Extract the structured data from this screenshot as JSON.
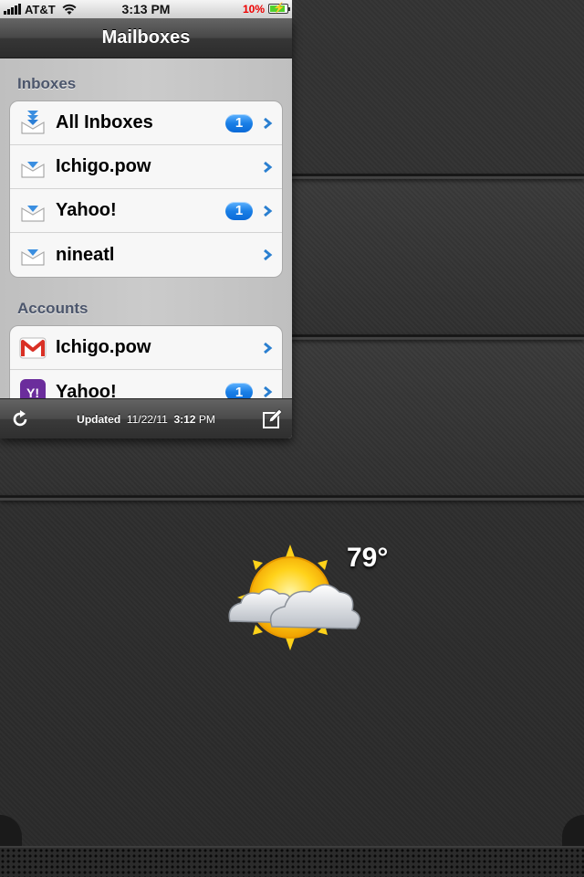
{
  "status_bar": {
    "carrier": "AT&T",
    "time": "3:13 PM",
    "battery_percent": "10%",
    "signal_bars": 4
  },
  "mail": {
    "title": "Mailboxes",
    "sections": [
      {
        "header": "Inboxes",
        "rows": [
          {
            "label": "All Inboxes",
            "badge": "1",
            "icon": "all-inboxes-icon"
          },
          {
            "label": "Ichigo.pow",
            "badge": "",
            "icon": "inbox-tray-icon"
          },
          {
            "label": "Yahoo!",
            "badge": "1",
            "icon": "inbox-tray-icon"
          },
          {
            "label": "nineatl",
            "badge": "",
            "icon": "inbox-tray-icon"
          }
        ]
      },
      {
        "header": "Accounts",
        "rows": [
          {
            "label": "Ichigo.pow",
            "badge": "",
            "icon": "gmail-icon"
          },
          {
            "label": "Yahoo!",
            "badge": "1",
            "icon": "yahoo-icon"
          }
        ]
      }
    ],
    "toolbar": {
      "updated_label": "Updated",
      "updated_date": "11/22/11",
      "updated_time": "3:12",
      "updated_ampm": "PM"
    }
  },
  "weather": {
    "temperature": "79°",
    "condition_icon": "partly-cloudy-icon"
  },
  "colors": {
    "badge_blue": "#1a7fe6",
    "chevron_blue": "#2a7fd0",
    "section_header": "#4c566c",
    "battery_low_red": "#e00000"
  }
}
